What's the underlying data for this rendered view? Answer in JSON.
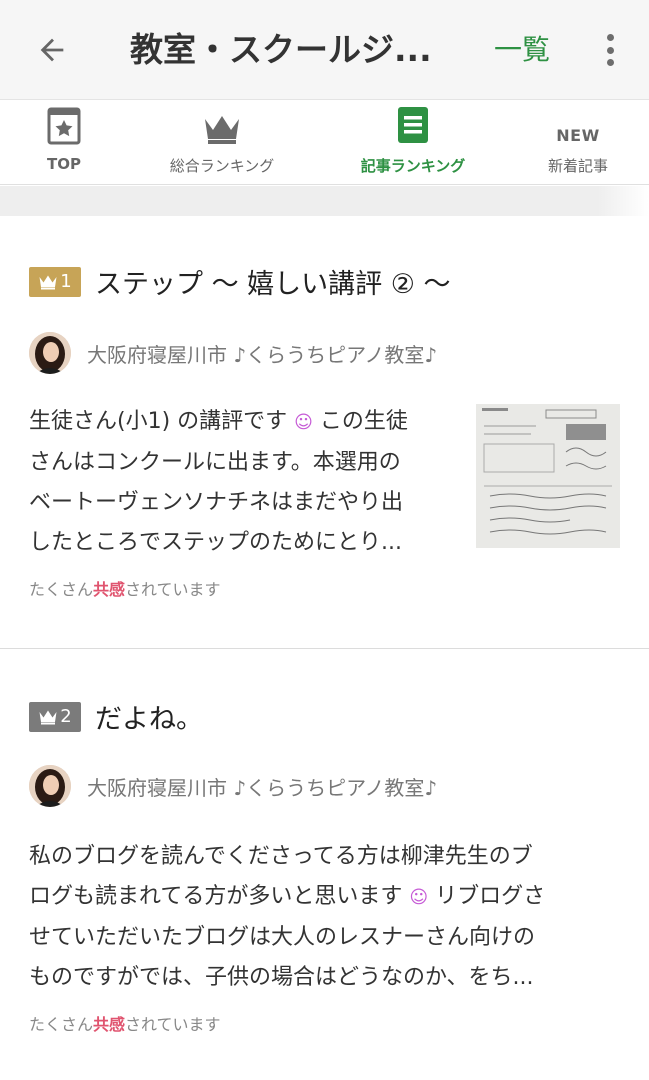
{
  "header": {
    "title": "教室・スクールジ...",
    "list_label": "一覧"
  },
  "tabs": [
    {
      "label": "TOP",
      "icon": "star-calendar-icon"
    },
    {
      "label": "総合ランキング",
      "icon": "crown-icon"
    },
    {
      "label": "記事ランキング",
      "icon": "document-list-icon",
      "active": true
    },
    {
      "label": "新着記事",
      "icon_text": "NEW"
    }
  ],
  "articles": [
    {
      "rank": "1",
      "title": "ステップ 〜 嬉しい講評 ② 〜",
      "author": "大阪府寝屋川市 ♪くらうちピアノ教室♪",
      "excerpt_lines": [
        "生徒さん(小1) の講評です",
        "さんはコンクールに出ます。本選用の",
        "ベートーヴェンソナチネはまだやり出",
        "したところでステップのためにとり..."
      ],
      "excerpt_emoji": "☺",
      "excerpt_line1_tail": " この生徒",
      "empathy_prefix": "たくさん",
      "empathy_highlight": "共感",
      "empathy_suffix": "されています"
    },
    {
      "rank": "2",
      "title": "だよね。",
      "author": "大阪府寝屋川市 ♪くらうちピアノ教室♪",
      "excerpt_lines": [
        "私のブログを読んでくださってる方は柳津先生のブ",
        "ログも読まれてる方が多いと思います",
        "せていただいたブログは大人のレスナーさん向けの",
        "ものですがでは、子供の場合はどうなのか、をち..."
      ],
      "excerpt_emoji": "☺",
      "excerpt_line2_tail": " リブログさ",
      "empathy_prefix": "たくさん",
      "empathy_highlight": "共感",
      "empathy_suffix": "されています"
    }
  ],
  "colors": {
    "accent_green": "#2e9143",
    "rank_gold": "#c7a457",
    "rank_gray": "#7b7b7b",
    "empathy_pink": "#e0546f"
  }
}
